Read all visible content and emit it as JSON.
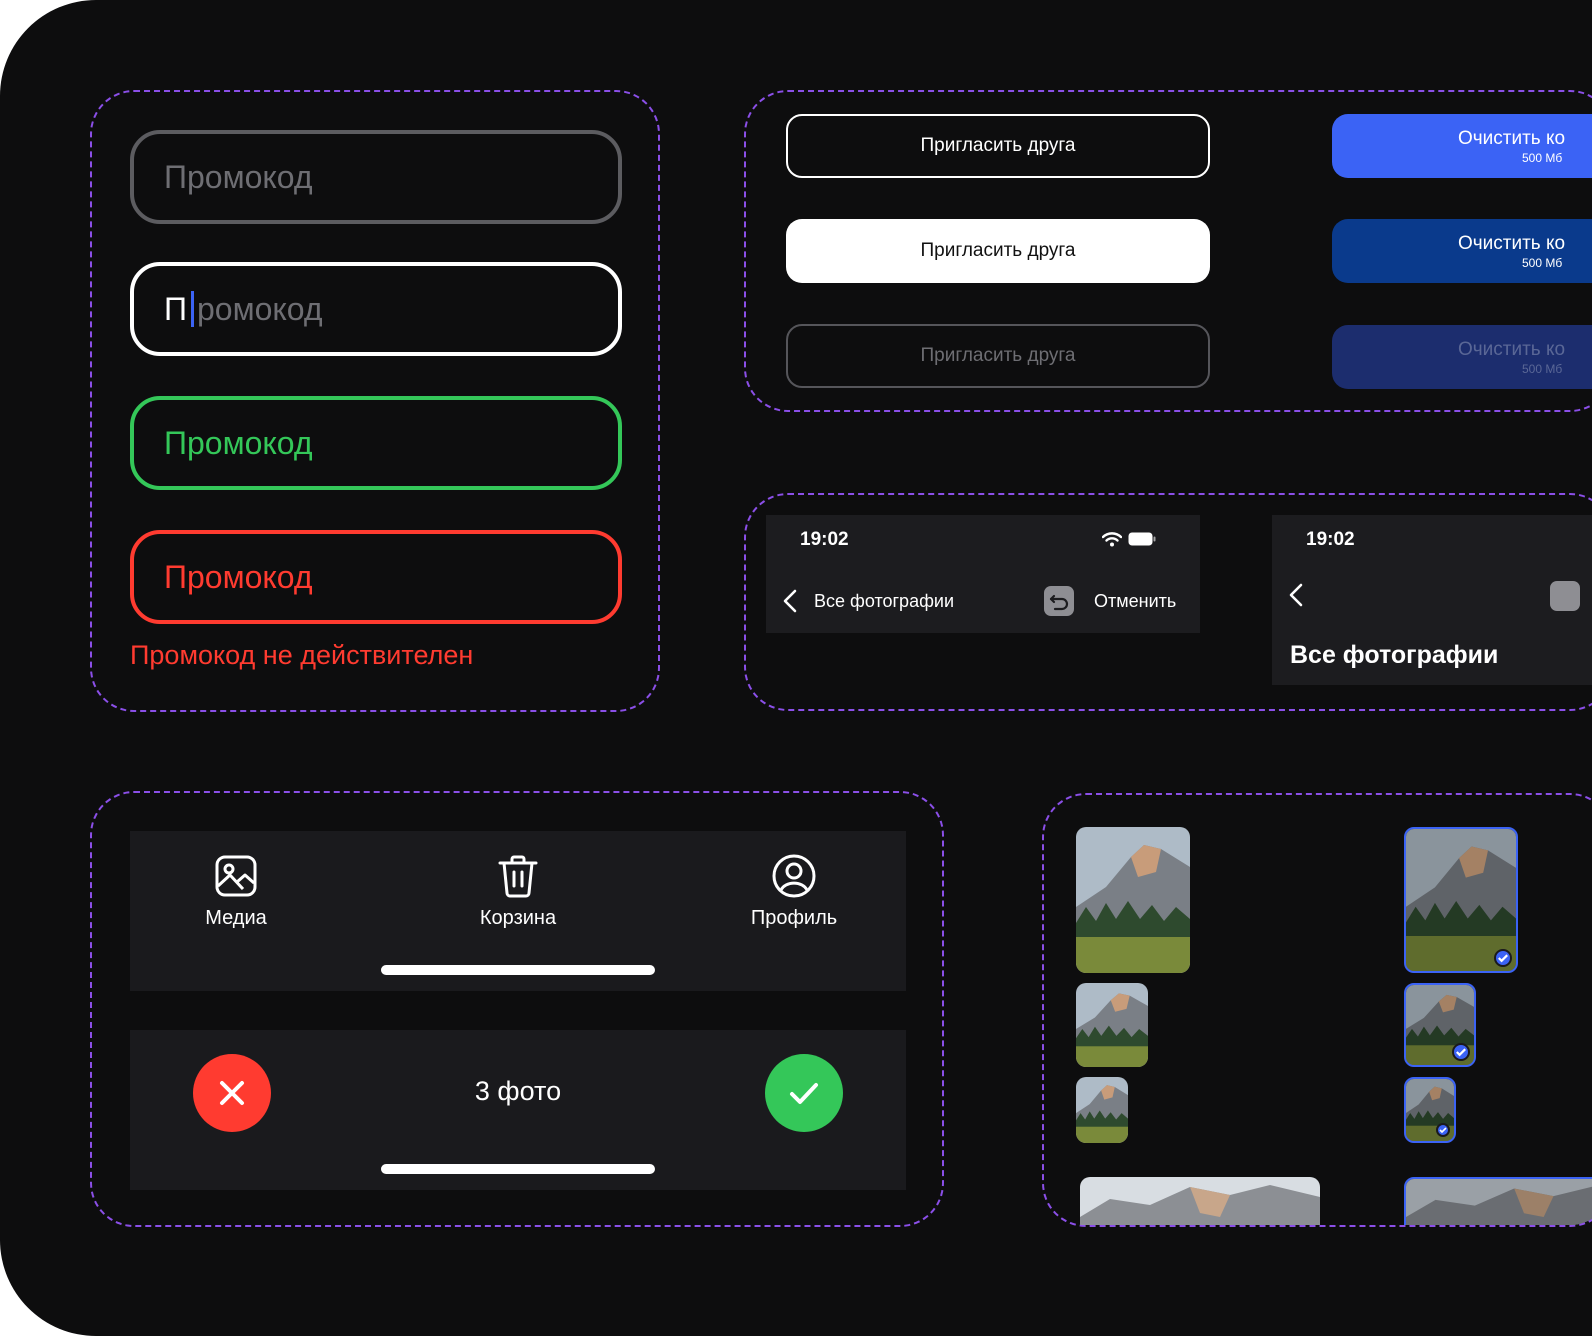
{
  "inputs": {
    "placeholder": "Промокод",
    "typed_char": "П",
    "typed_rest": "ромокод",
    "error_message": "Промокод не действителен"
  },
  "buttons": {
    "invite_label": "Пригласить друга",
    "clear_label": "Очистить ко",
    "clear_size": "500 Мб"
  },
  "navbars": {
    "time": "19:02",
    "back_title": "Все фотографии",
    "cancel_label": "Отменить",
    "large_title": "Все фотографии"
  },
  "tabbar": {
    "items": [
      {
        "label": "Медиа",
        "icon": "media-icon"
      },
      {
        "label": "Корзина",
        "icon": "trash-icon"
      },
      {
        "label": "Профиль",
        "icon": "profile-icon"
      }
    ]
  },
  "actionbar": {
    "count_label": "3 фото"
  },
  "colors": {
    "background": "#0d0d0e",
    "dashed_border": "#8b4fe8",
    "success": "#34c759",
    "error": "#ff3b30",
    "primary_blue": "#3b63f5",
    "pressed_blue": "#0a3a8c",
    "disabled_blue": "#1c2d6e"
  }
}
